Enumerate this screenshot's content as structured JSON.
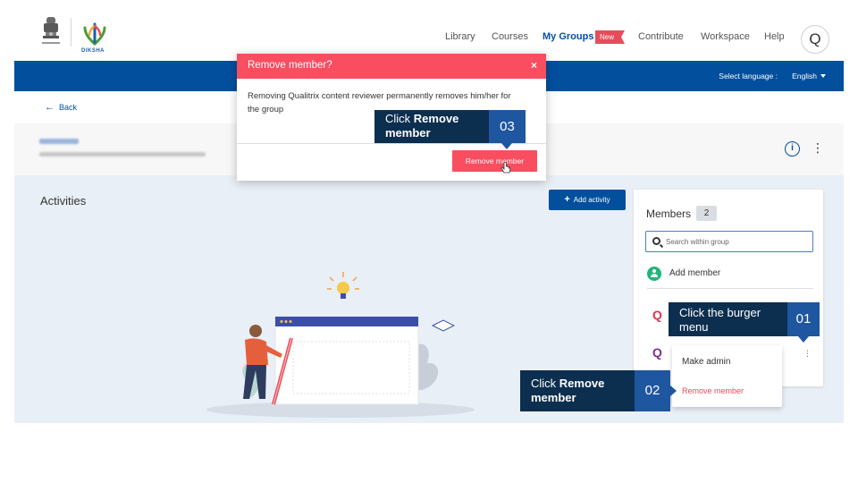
{
  "header": {
    "logo_text": "DIKSHA",
    "nav": [
      {
        "label": "Library"
      },
      {
        "label": "Courses"
      },
      {
        "label": "My Groups",
        "active": true
      },
      {
        "label": "Contribute"
      },
      {
        "label": "Workspace"
      },
      {
        "label": "Help"
      }
    ],
    "new_badge": "New",
    "avatar_letter": "Q"
  },
  "language_bar": {
    "label": "Select language :",
    "value": "English"
  },
  "back_label": "Back",
  "main": {
    "activities_title": "Activities",
    "add_activity_label": "Add activity"
  },
  "members": {
    "title": "Members",
    "count": "2",
    "search_placeholder": "Search within group",
    "add_member_label": "Add member",
    "avatars": [
      "Q",
      "Q"
    ]
  },
  "context_menu": {
    "make_admin": "Make admin",
    "remove_member": "Remove member"
  },
  "modal": {
    "title": "Remove member?",
    "close_glyph": "×",
    "body": "Removing Qualitrix content reviewer permanently removes him/her for the group",
    "confirm_label": "Remove member"
  },
  "callouts": {
    "c01": {
      "text": "Click the burger menu",
      "num": "01"
    },
    "c02": {
      "prefix": "Click ",
      "bold": "Remove member",
      "num": "02"
    },
    "c03": {
      "prefix": "Click ",
      "bold": "Remove member",
      "num": "03"
    }
  },
  "colors": {
    "primary": "#024f9d",
    "danger": "#f94d60",
    "callout_dark": "#0c2e4f",
    "callout_num": "#1e56a0",
    "add_member_green": "#1fb57c"
  }
}
